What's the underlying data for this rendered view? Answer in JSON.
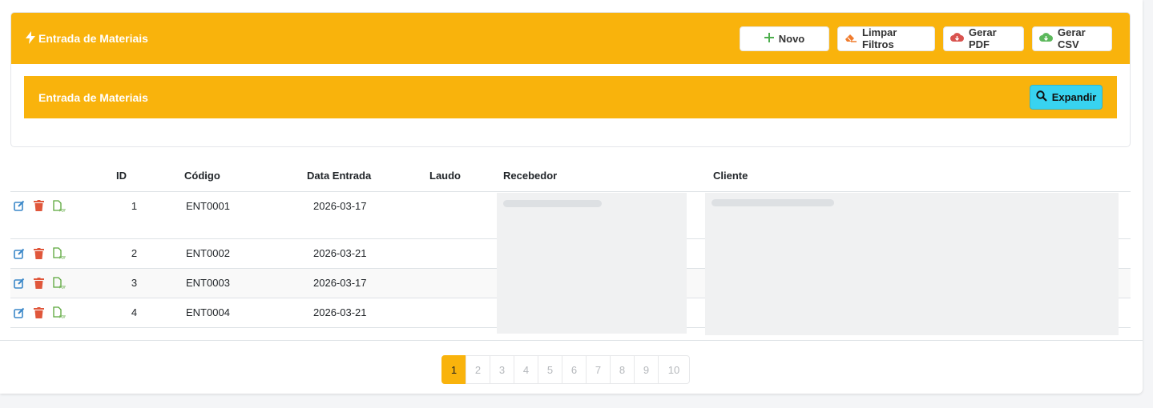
{
  "header": {
    "title": "Entrada de Materiais",
    "buttons": {
      "novo": "Novo",
      "limpar": "Limpar Filtros",
      "pdf": "Gerar PDF",
      "csv": "Gerar CSV"
    }
  },
  "filter": {
    "title": "Entrada de Materiais",
    "expand_label": "Expandir"
  },
  "table": {
    "columns": {
      "id": "ID",
      "codigo": "Código",
      "data": "Data Entrada",
      "laudo": "Laudo",
      "recebedor": "Recebedor",
      "cliente": "Cliente"
    },
    "rows": [
      {
        "id": "1",
        "codigo": "ENT0001",
        "data": "2026-03-17",
        "laudo": ""
      },
      {
        "id": "2",
        "codigo": "ENT0002",
        "data": "2026-03-21",
        "laudo": ""
      },
      {
        "id": "3",
        "codigo": "ENT0003",
        "data": "2026-03-17",
        "laudo": ""
      },
      {
        "id": "4",
        "codigo": "ENT0004",
        "data": "2026-03-21",
        "laudo": ""
      }
    ]
  },
  "pagination": {
    "pages": [
      "1",
      "2",
      "3",
      "4",
      "5",
      "6",
      "7",
      "8",
      "9",
      "10"
    ],
    "current": "1"
  },
  "colors": {
    "accent": "#f9b30c",
    "expand": "#38d3f0",
    "edit_icon": "#3a87c8",
    "delete_icon": "#e0573b",
    "pdf_icon": "#5aa63a"
  },
  "icons": {
    "title": "bolt-icon",
    "novo": "plus-icon",
    "limpar": "eraser-icon",
    "pdf": "cloud-download-icon",
    "csv": "cloud-download-icon",
    "expand": "search-icon",
    "row_edit": "edit-icon",
    "row_delete": "trash-icon",
    "row_pdf": "pdf-file-icon"
  }
}
